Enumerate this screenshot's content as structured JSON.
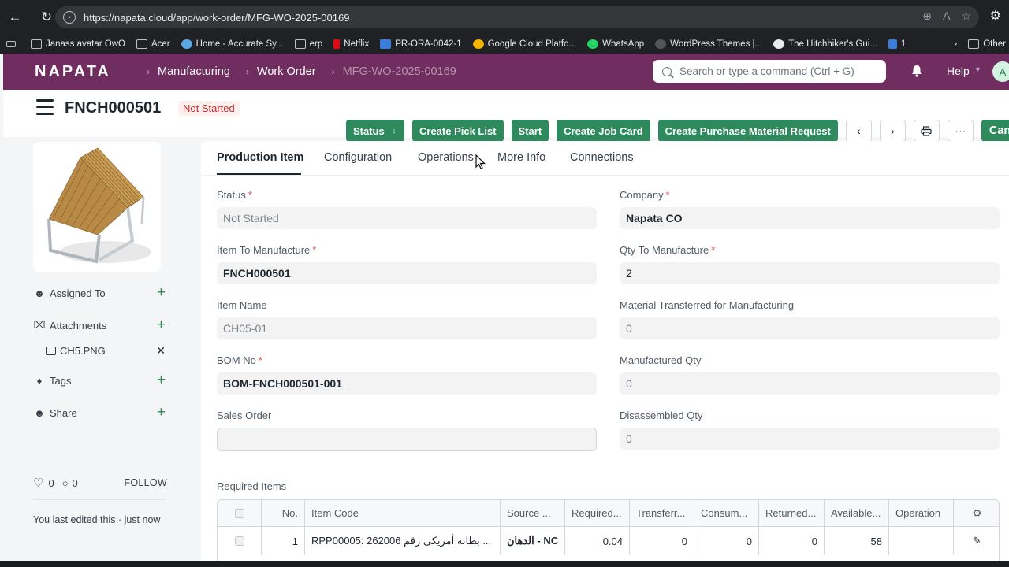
{
  "browser": {
    "url": "https://napata.cloud/app/work-order/MFG-WO-2025-00169",
    "bookmarks": [
      "Janass avatar OwO",
      "Acer",
      "Home - Accurate Sy...",
      "erp",
      "Netflix",
      "PR-ORA-0042-1",
      "Google Cloud Platfo...",
      "WhatsApp",
      "WordPress Themes |...",
      "The Hitchhiker's Gui...",
      "1"
    ],
    "bookmarks_other": "Other"
  },
  "navbar": {
    "logo": "NAPATA",
    "breadcrumbs": [
      "Manufacturing",
      "Work Order",
      "MFG-WO-2025-00169"
    ],
    "search_placeholder": "Search or type a command (Ctrl + G)",
    "help": "Help",
    "avatar_initial": "A"
  },
  "page": {
    "title": "FNCH000501",
    "status": "Not Started",
    "actions": {
      "status": "Status",
      "create_pick_list": "Create Pick List",
      "start": "Start",
      "create_job_card": "Create Job Card",
      "create_purchase_material_request": "Create Purchase Material Request",
      "cancel": "Cancel",
      "more": "···"
    }
  },
  "sidebar": {
    "assigned_to": "Assigned To",
    "attachments": "Attachments",
    "attachment_file": "CH5.PNG",
    "tags": "Tags",
    "share": "Share",
    "likes": "0",
    "comments": "0",
    "follow": "FOLLOW",
    "last_edit": "You last edited this · just now"
  },
  "tabs": [
    "Production Item",
    "Configuration",
    "Operations",
    "More Info",
    "Connections"
  ],
  "form": {
    "status_label": "Status",
    "status_value": "Not Started",
    "company_label": "Company",
    "company_value": "Napata CO",
    "item_to_manufacture_label": "Item To Manufacture",
    "item_to_manufacture_value": "FNCH000501",
    "qty_to_manufacture_label": "Qty To Manufacture",
    "qty_to_manufacture_value": "2",
    "item_name_label": "Item Name",
    "item_name_value": "CH05-01",
    "material_transferred_label": "Material Transferred for Manufacturing",
    "material_transferred_value": "0",
    "bom_no_label": "BOM No",
    "bom_no_value": "BOM-FNCH000501-001",
    "manufactured_qty_label": "Manufactured Qty",
    "manufactured_qty_value": "0",
    "sales_order_label": "Sales Order",
    "sales_order_value": "",
    "disassembled_qty_label": "Disassembled Qty",
    "disassembled_qty_value": "0"
  },
  "required_items": {
    "title": "Required Items",
    "columns": [
      "No.",
      "Item Code",
      "Source ...",
      "Required...",
      "Transferr...",
      "Consum...",
      "Returned...",
      "Available...",
      "Operation"
    ],
    "rows": [
      {
        "no": "1",
        "item_code": "RPP00005: 262006 بطانه أمريكى رقم ...",
        "source": "الدهان - NC",
        "required": "0.04",
        "transferred": "0",
        "consumed": "0",
        "returned": "0",
        "available": "58",
        "operation": ""
      }
    ]
  },
  "colors": {
    "navbar": "#6f2e5f",
    "primary_button": "#2e8a5c",
    "status_pill_bg": "#fff0f0",
    "status_pill_text": "#cc2929"
  }
}
